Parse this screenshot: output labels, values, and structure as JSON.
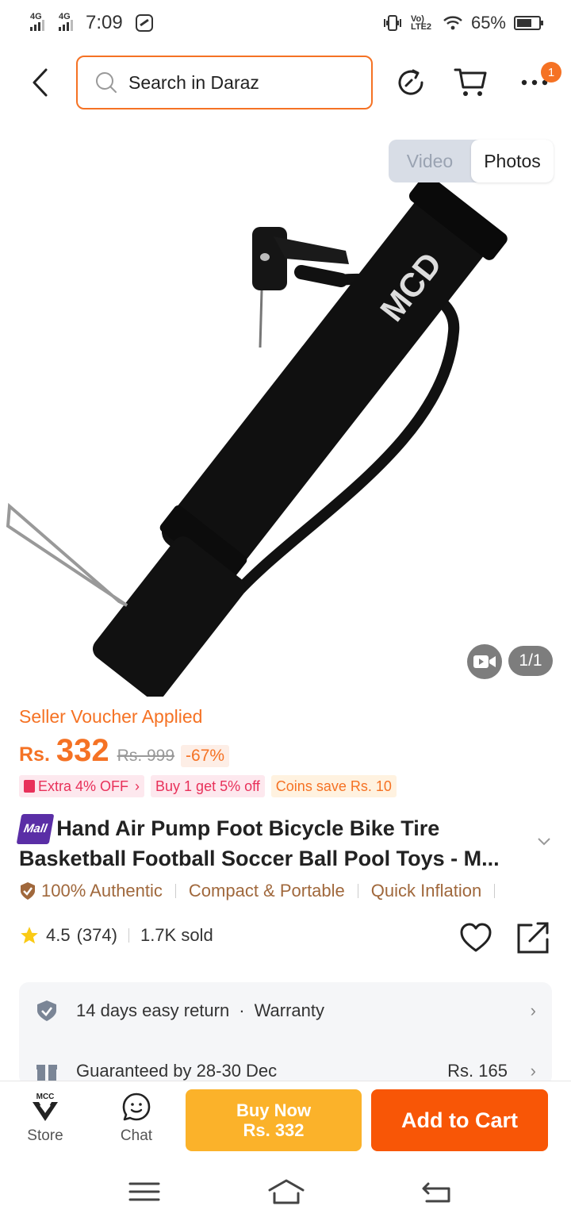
{
  "status_bar": {
    "net1": "4G",
    "net2": "4G",
    "time": "7:09",
    "volte": "Vo) LTE2",
    "battery": "65%"
  },
  "header": {
    "search_placeholder": "Search in Daraz",
    "cart_badge": "1"
  },
  "gallery": {
    "tabs": [
      "Video",
      "Photos"
    ],
    "active_tab": "Photos",
    "page_indicator": "1/1",
    "product_brand_mark": "MCD"
  },
  "pricing": {
    "voucher_label": "Seller Voucher Applied",
    "currency": "Rs.",
    "price": "332",
    "original_price": "Rs. 999",
    "discount": "-67%",
    "promos": [
      "Extra 4% OFF",
      "Buy 1 get 5% off",
      "Coins save Rs. 10"
    ]
  },
  "product": {
    "mall_badge": "Mall",
    "title": "Hand Air Pump Foot Bicycle Bike Tire Basketball Football Soccer Ball Pool Toys - M...",
    "features": [
      "100% Authentic",
      "Compact & Portable",
      "Quick Inflation"
    ],
    "rating": "4.5",
    "rating_count": "(374)",
    "sold": "1.7K sold"
  },
  "services": {
    "return": "14 days easy return",
    "dot": "·",
    "warranty": "Warranty",
    "delivery": "Guaranteed by 28-30 Dec",
    "delivery_fee": "Rs. 165"
  },
  "actions": {
    "store": "Store",
    "store_logo_text": "MCC",
    "chat": "Chat",
    "buy_now_line1": "Buy Now",
    "buy_now_line2": "Rs. 332",
    "add_to_cart": "Add to Cart"
  },
  "colors": {
    "accent": "#f57224",
    "buy_now": "#fbb22a",
    "add_to_cart": "#f85606",
    "feature_text": "#a0683c"
  }
}
